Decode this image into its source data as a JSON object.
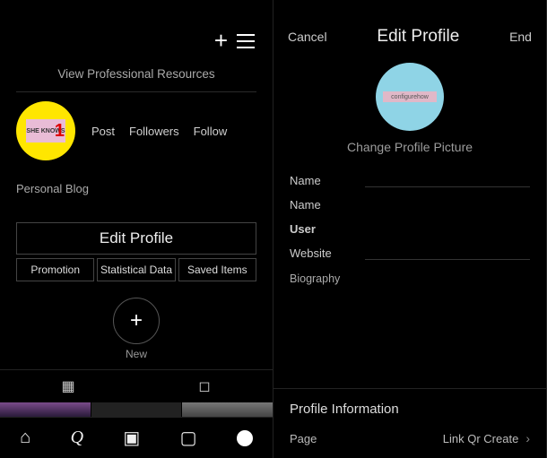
{
  "left": {
    "professional_link": "View Professional Resources",
    "avatar_text": "SHE KNOWS",
    "avatar_badge": "1",
    "stats": {
      "post": "Post",
      "followers": "Followers",
      "follow": "Follow"
    },
    "bio": "Personal Blog",
    "edit_profile": "Edit Profile",
    "buttons": {
      "promotion": "Promotion",
      "statistical": "Statistical Data",
      "saved": "Saved Items"
    },
    "new_label": "New",
    "tabs": {
      "grid": "grid",
      "tagged": "tagged"
    }
  },
  "right": {
    "cancel": "Cancel",
    "title": "Edit Profile",
    "done": "End",
    "avatar_chip": "configurehow",
    "change_pic": "Change Profile Picture",
    "fields": {
      "name": "Name",
      "name2": "Name",
      "user": "User",
      "website": "Website",
      "biography": "Biography"
    },
    "section": "Profile Information",
    "page_label": "Page",
    "page_value": "Link Qr Create"
  }
}
